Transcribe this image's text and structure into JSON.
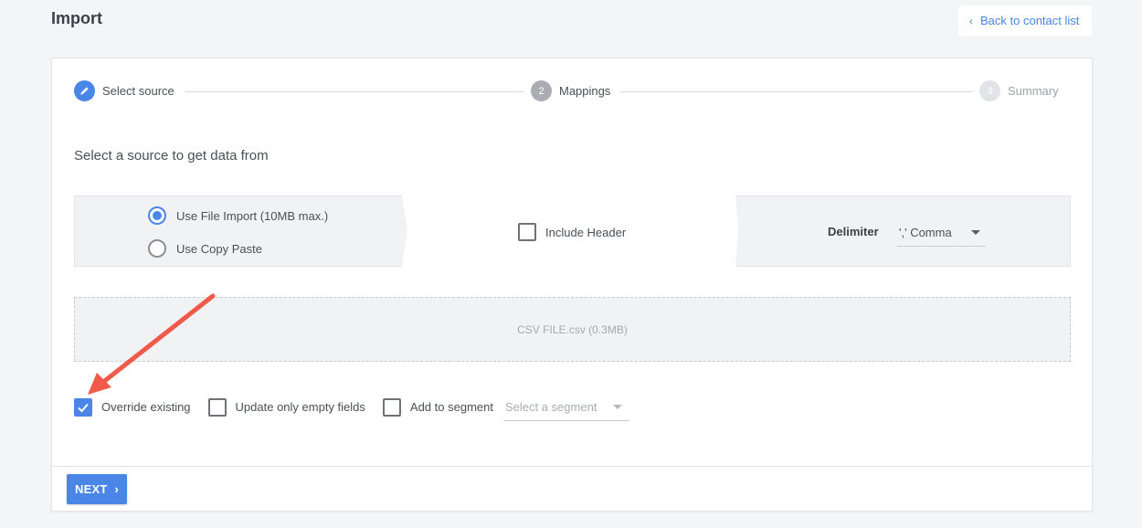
{
  "header": {
    "title": "Import",
    "back_link": "Back to contact list"
  },
  "stepper": {
    "steps": [
      {
        "number": "",
        "label": "Select source",
        "state": "active"
      },
      {
        "number": "2",
        "label": "Mappings",
        "state": "pending"
      },
      {
        "number": "3",
        "label": "Summary",
        "state": "disabled"
      }
    ]
  },
  "main": {
    "section_title": "Select a source to get data from",
    "source": {
      "options": [
        {
          "label": "Use File Import (10MB max.)",
          "checked": true
        },
        {
          "label": "Use Copy Paste",
          "checked": false
        }
      ],
      "include_header_label": "Include Header",
      "include_header_checked": false,
      "delimiter_label": "Delimiter",
      "delimiter_value": "',' Comma"
    },
    "file_name": "CSV FILE.csv (0.3MB)",
    "options": {
      "override_existing": {
        "label": "Override existing",
        "checked": true
      },
      "update_empty": {
        "label": "Update only empty fields",
        "checked": false
      },
      "add_to_segment": {
        "label": "Add to segment",
        "checked": false
      },
      "segment_placeholder": "Select a segment"
    }
  },
  "footer": {
    "next_label": "NEXT"
  },
  "colors": {
    "accent": "#4a86e8",
    "annotation": "#f05a4a"
  }
}
